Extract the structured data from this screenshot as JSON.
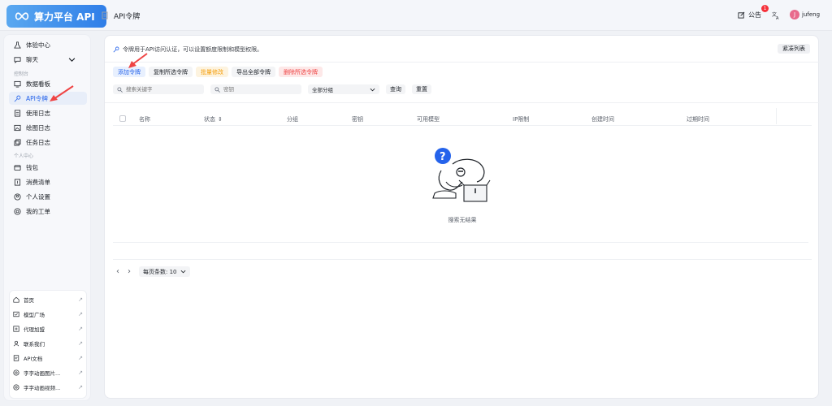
{
  "header": {
    "app_name": "算力平台 API",
    "page_title": "API令牌",
    "notice_label": "公告",
    "notice_count": "1",
    "user_initial": "J",
    "user_name": "jufeng"
  },
  "sidebar": {
    "items": [
      {
        "label": "体验中心",
        "icon": "flask-icon"
      },
      {
        "label": "聊天",
        "icon": "chat-icon"
      }
    ],
    "section_console": "控制台",
    "console_items": [
      {
        "label": "数据看板",
        "icon": "monitor-icon"
      },
      {
        "label": "API令牌",
        "icon": "key-icon",
        "active": true
      },
      {
        "label": "使用日志",
        "icon": "log-icon"
      },
      {
        "label": "绘图日志",
        "icon": "image-icon"
      },
      {
        "label": "任务日志",
        "icon": "task-icon"
      }
    ],
    "section_personal": "个人中心",
    "personal_items": [
      {
        "label": "钱包",
        "icon": "wallet-icon"
      },
      {
        "label": "消费清单",
        "icon": "receipt-icon"
      },
      {
        "label": "个人设置",
        "icon": "user-settings-icon"
      },
      {
        "label": "我的工单",
        "icon": "ticket-icon"
      }
    ],
    "bottom_links": [
      {
        "label": "首页",
        "icon": "home-icon"
      },
      {
        "label": "模型广场",
        "icon": "store-icon"
      },
      {
        "label": "代理加盟",
        "icon": "plus-square-icon"
      },
      {
        "label": "联系我们",
        "icon": "contact-icon"
      },
      {
        "label": "API文档",
        "icon": "doc-icon"
      },
      {
        "label": "字字动画图片...",
        "icon": "smile-icon"
      },
      {
        "label": "字字动画视频...",
        "icon": "smile-icon"
      }
    ]
  },
  "main": {
    "info_text": "令牌用于API访问认证，可以设置额度限制和模型权限。",
    "compact_label": "紧凑列表",
    "actions": {
      "add": "添加令牌",
      "copy": "复制所选令牌",
      "batch": "批量修改",
      "export": "导出全部令牌",
      "delete": "删除所选令牌"
    },
    "filters": {
      "keyword_placeholder": "搜索关键字",
      "key_placeholder": "密钥",
      "group_value": "全部分组",
      "query": "查询",
      "reset": "重置"
    },
    "columns": [
      "名称",
      "状态",
      "分组",
      "密钥",
      "可用模型",
      "IP限制",
      "创建时间",
      "过期时间"
    ],
    "empty_text": "搜索无结果",
    "pager": {
      "page_size_label": "每页条数: 10"
    }
  },
  "colors": {
    "accent": "#2563eb",
    "danger": "#ef4444",
    "warning": "#f59e0b",
    "annotation_arrow": "#ef4444"
  }
}
